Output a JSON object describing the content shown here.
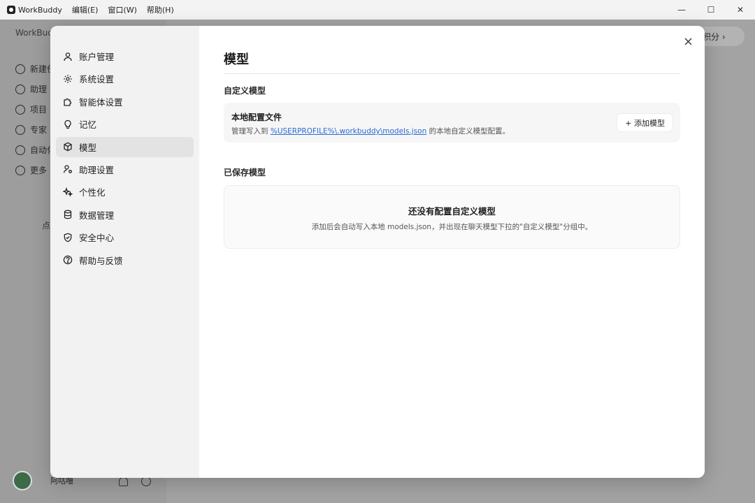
{
  "window": {
    "app_title": "WorkBuddy",
    "menu": [
      "编辑(E)",
      "窗口(W)",
      "帮助(H)"
    ],
    "controls": {
      "minimize": "—",
      "maximize": "☐",
      "close": "✕"
    }
  },
  "background": {
    "app_name": "WorkBudd",
    "nav": [
      "新建任",
      "助理",
      "项目",
      "专家",
      "自动化",
      "更多"
    ],
    "hint": "点",
    "user_name": "阿咕噜",
    "points_label": "积分 ›"
  },
  "settings": {
    "nav": [
      {
        "label": "账户管理",
        "icon": "user-icon"
      },
      {
        "label": "系统设置",
        "icon": "gear-icon"
      },
      {
        "label": "智能体设置",
        "icon": "puzzle-icon"
      },
      {
        "label": "记忆",
        "icon": "lightbulb-icon"
      },
      {
        "label": "模型",
        "icon": "cube-icon",
        "active": true
      },
      {
        "label": "助理设置",
        "icon": "user-gear-icon"
      },
      {
        "label": "个性化",
        "icon": "sparkle-icon"
      },
      {
        "label": "数据管理",
        "icon": "database-icon"
      },
      {
        "label": "安全中心",
        "icon": "shield-icon"
      },
      {
        "label": "帮助与反馈",
        "icon": "help-icon"
      }
    ],
    "close_label": "×"
  },
  "model_page": {
    "title": "模型",
    "custom_section": "自定义模型",
    "config_title": "本地配置文件",
    "config_desc_prefix": "管理写入到 ",
    "config_path": "%USERPROFILE%\\.workbuddy\\models.json",
    "config_desc_suffix": " 的本地自定义模型配置。",
    "add_button": "+ 添加模型",
    "saved_section": "已保存模型",
    "empty_title": "还没有配置自定义模型",
    "empty_desc": "添加后会自动写入本地 models.json，并出现在聊天模型下拉的\"自定义模型\"分组中。"
  }
}
